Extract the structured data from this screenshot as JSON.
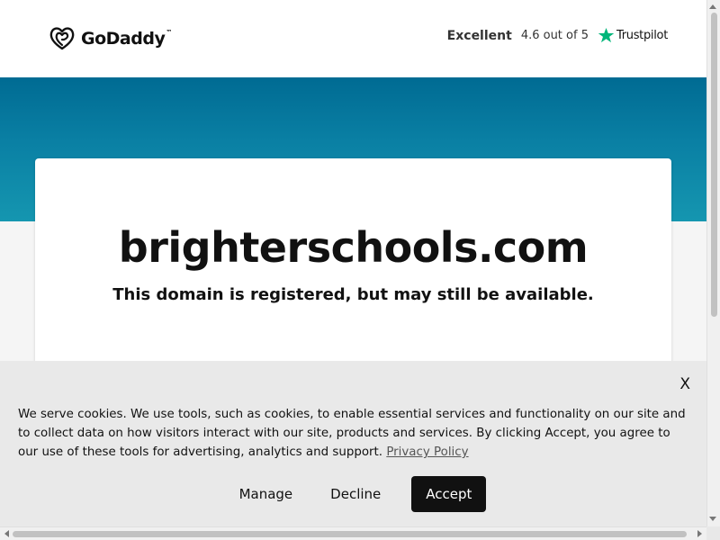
{
  "header": {
    "logo_text": "GoDaddy",
    "logo_tm": "™",
    "logo_icon": "godaddy-heart-logo",
    "rating_label": "Excellent",
    "rating_score": "4.6 out of 5",
    "trustpilot_text": "Trustpilot",
    "trustpilot_icon": "star-icon",
    "trustpilot_color": "#00b67a"
  },
  "hero": {
    "domain": "brighterschools.com",
    "subtitle": "This domain is registered, but may still be available.",
    "band_color": "#0a80a4"
  },
  "cookie_banner": {
    "close_label": "X",
    "text": "We serve cookies. We use tools, such as cookies, to enable essential services and functionality on our site and to collect data on how visitors interact with our site, products and services. By clicking Accept, you agree to our use of these tools for advertising, analytics and support.",
    "privacy_link": "Privacy Policy",
    "manage_label": "Manage",
    "decline_label": "Decline",
    "accept_label": "Accept"
  }
}
